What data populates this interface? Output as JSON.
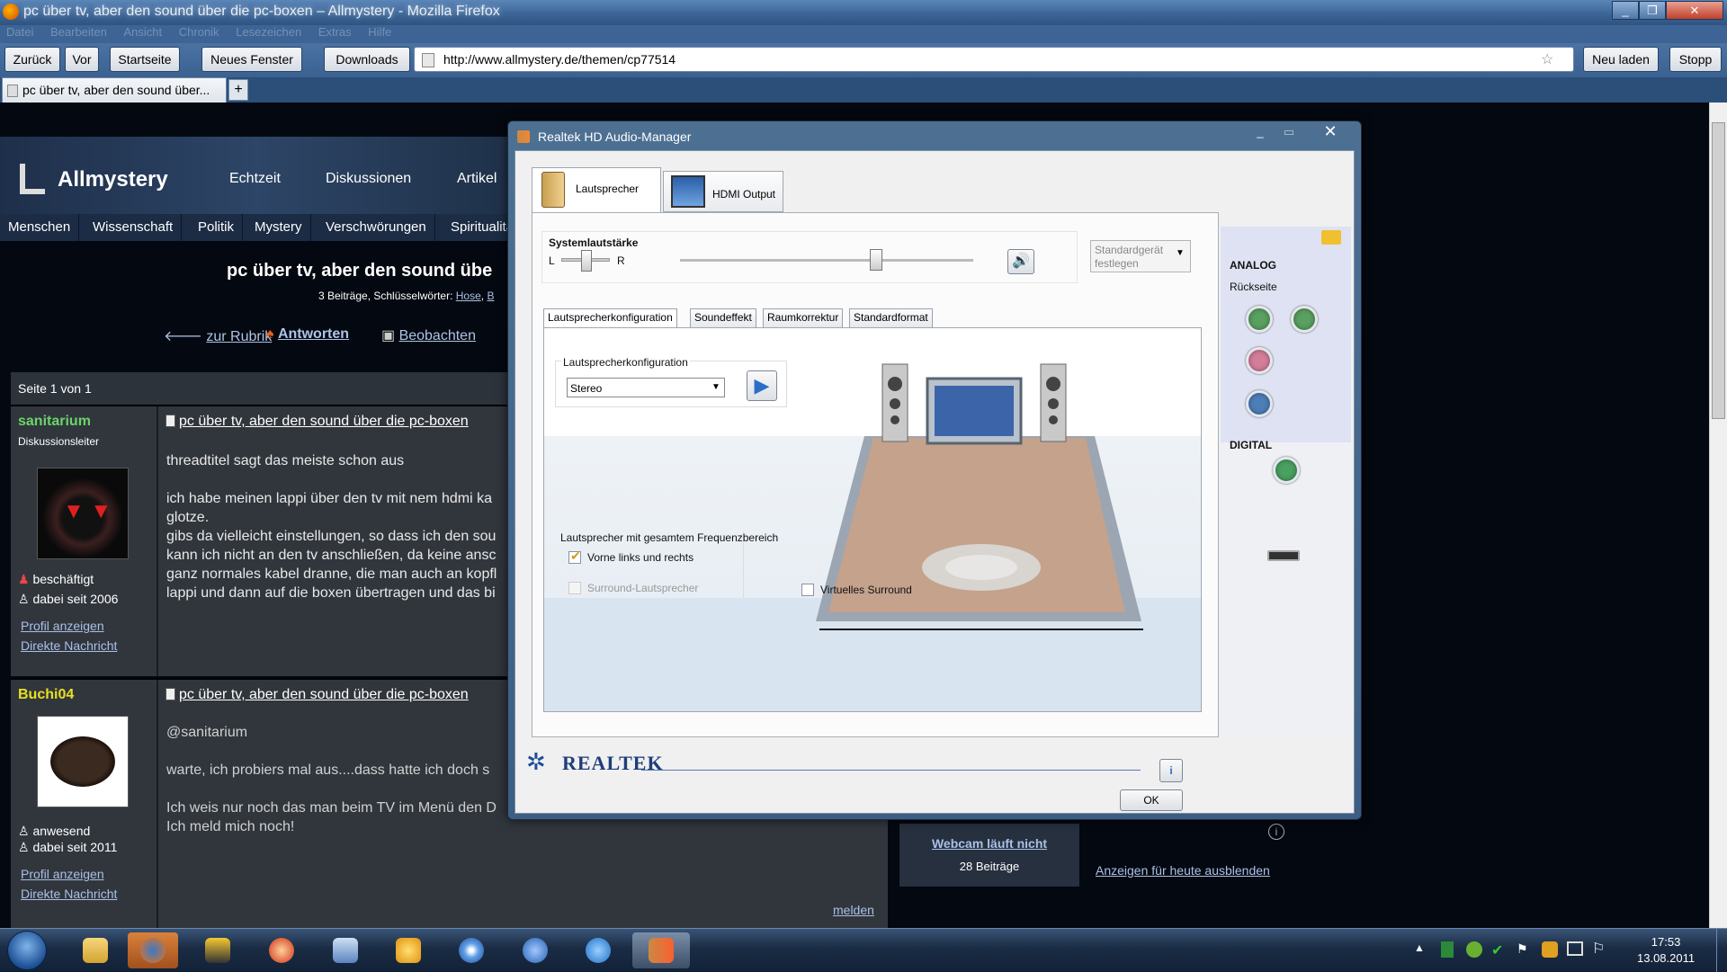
{
  "firefox": {
    "window_title": "pc über tv, aber den sound über die pc-boxen – Allmystery - Mozilla Firefox",
    "menu": [
      "Datei",
      "Bearbeiten",
      "Ansicht",
      "Chronik",
      "Lesezeichen",
      "Extras",
      "Hilfe"
    ],
    "nav": {
      "back": "Zurück",
      "forward": "Vor",
      "home": "Startseite",
      "new_window": "Neues Fenster",
      "downloads": "Downloads",
      "reload": "Neu laden",
      "stop": "Stopp"
    },
    "url": "http://www.allmystery.de/themen/cp77514",
    "tab_label": "pc über tv, aber den sound über...",
    "tab_add": "+"
  },
  "site": {
    "logo": "Allmystery",
    "nav": [
      "Echtzeit",
      "Diskussionen",
      "Artikel"
    ],
    "subnav": [
      "Menschen",
      "Wissenschaft",
      "Politik",
      "Mystery",
      "Verschwörungen",
      "Spiritualität"
    ],
    "thread_title": "pc über tv, aber den sound übe",
    "meta_prefix": "3 Beiträge, Schlüsselwörter: ",
    "meta_kw1": "Hose",
    "meta_kw2": "B",
    "actions": {
      "back": "zur Rubrik",
      "reply": "Antworten",
      "watch": "Beobachten"
    },
    "page_info": "Seite 1 von 1",
    "posts": [
      {
        "user": "sanitarium",
        "role": "Diskussionsleiter",
        "status": "beschäftigt",
        "since": "dabei seit 2006",
        "profile": "Profil anzeigen",
        "message": "Direkte Nachricht",
        "title": "pc über tv, aber den sound über die pc-boxen",
        "text": "threadtitel sagt das meiste schon aus\n\nich habe meinen lappi über den tv mit nem hdmi ka\nglotze.\ngibs da vielleicht einstellungen, so dass ich den sou\nkann ich nicht an den tv anschließen, da keine ansc\nganz normales kabel dranne, die man auch an kopfl\nlappi und dann auf die boxen übertragen und das bi"
      },
      {
        "user": "Buchi04",
        "role": "",
        "status": "anwesend",
        "since": "dabei seit 2011",
        "profile": "Profil anzeigen",
        "message": "Direkte Nachricht",
        "title": "pc über tv, aber den sound über die pc-boxen",
        "text": "@sanitarium\n\nwarte, ich probiers mal aus....dass hatte ich doch s\n\nIch weis nur noch das man beim TV im Menü den D\nIch meld mich noch!",
        "report": "melden"
      }
    ],
    "right_card": {
      "title": "Webcam läuft nicht",
      "count": "28 Beiträge",
      "hide_ads": "Anzeigen für heute ausblenden"
    }
  },
  "realtek": {
    "title": "Realtek HD Audio-Manager",
    "tabs": [
      "Lautsprecher",
      "HDMI Output"
    ],
    "volume_label": "Systemlautstärke",
    "balance_left": "L",
    "balance_right": "R",
    "volume_level": 0.67,
    "balance_level": 0.5,
    "default_device": "Standardgerät festlegen",
    "subtabs": [
      "Lautsprecherkonfiguration",
      "Soundeffekt",
      "Raumkorrektur",
      "Standardformat"
    ],
    "config_label": "Lautsprecherkonfiguration",
    "config_value": "Stereo",
    "fullrange_label": "Lautsprecher mit gesamtem Frequenzbereich",
    "front_lr": "Vorne links und rechts",
    "front_lr_checked": true,
    "surround_speakers": "Surround-Lautsprecher",
    "virtual_surround": "Virtuelles Surround",
    "analog": "ANALOG",
    "back_panel": "Rückseite",
    "digital": "DIGITAL",
    "brand": "REALTEK",
    "ok": "OK"
  },
  "taskbar": {
    "time": "17:53",
    "date": "13.08.2011"
  }
}
